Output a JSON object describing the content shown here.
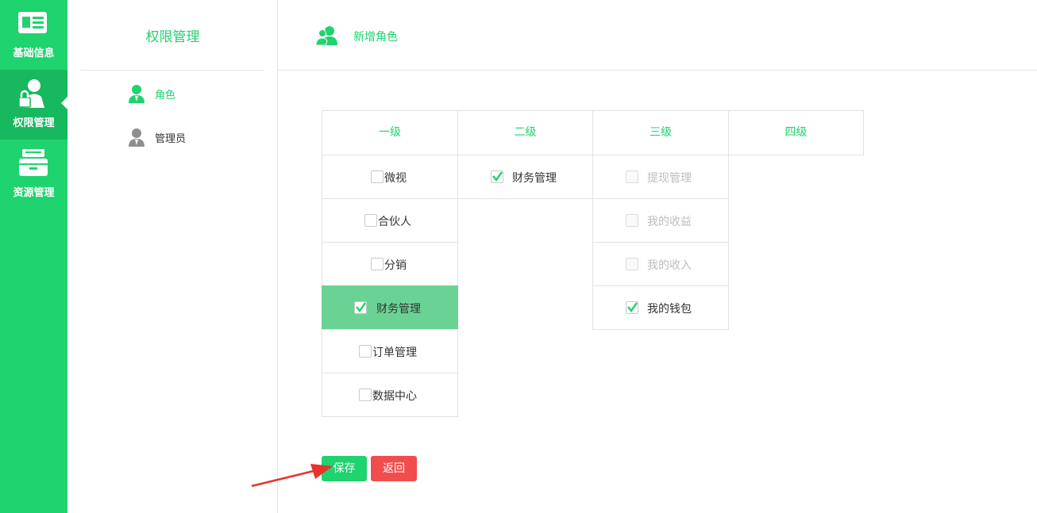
{
  "rail": {
    "items": [
      {
        "label": "基础信息",
        "icon": "id-card-icon"
      },
      {
        "label": "权限管理",
        "icon": "user-lock-icon",
        "active": true
      },
      {
        "label": "资源管理",
        "icon": "archive-box-icon"
      }
    ]
  },
  "sidebar": {
    "title": "权限管理",
    "items": [
      {
        "label": "角色",
        "icon": "user-icon",
        "active": true
      },
      {
        "label": "管理员",
        "icon": "admin-user-icon"
      }
    ]
  },
  "header": {
    "title": "新增角色",
    "icon": "users-icon"
  },
  "permissions": {
    "headers": [
      "一级",
      "二级",
      "三级",
      "四级"
    ],
    "level1": [
      {
        "label": "微视",
        "checked": false
      },
      {
        "label": "合伙人",
        "checked": false
      },
      {
        "label": "分销",
        "checked": false
      },
      {
        "label": "财务管理",
        "checked": true,
        "selected": true
      },
      {
        "label": "订单管理",
        "checked": false
      },
      {
        "label": "数据中心",
        "checked": false
      }
    ],
    "level2": [
      {
        "label": "财务管理",
        "checked": true
      }
    ],
    "level3": [
      {
        "label": "提现管理",
        "checked": false,
        "disabled": true
      },
      {
        "label": "我的收益",
        "checked": false,
        "disabled": true
      },
      {
        "label": "我的收入",
        "checked": false,
        "disabled": true
      },
      {
        "label": "我的钱包",
        "checked": true
      }
    ]
  },
  "actions": {
    "save_label": "保存",
    "back_label": "返回"
  },
  "colors": {
    "primary": "#1fd36e",
    "selected_row": "#6ad394",
    "danger": "#f24d4d",
    "annotation_arrow": "#e8332b"
  }
}
